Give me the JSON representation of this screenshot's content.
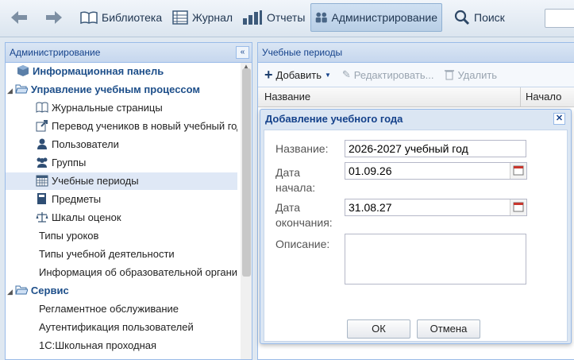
{
  "toolbar": {
    "library": "Библиотека",
    "journal": "Журнал",
    "reports": "Отчеты",
    "admin": "Администрирование",
    "search": "Поиск"
  },
  "left": {
    "title": "Администрирование",
    "collapse_glyph": "«",
    "items": [
      {
        "label": "Информационная панель",
        "icon": "info-panel-icon"
      },
      {
        "label": "Управление учебным процессом",
        "icon": "folder-icon"
      },
      {
        "label": "Журнальные страницы",
        "icon": "book-icon"
      },
      {
        "label": "Перевод учеников в новый учебный год",
        "icon": "transfer-icon"
      },
      {
        "label": "Пользователи",
        "icon": "user-icon"
      },
      {
        "label": "Группы",
        "icon": "group-icon"
      },
      {
        "label": "Учебные периоды",
        "icon": "calendar-icon"
      },
      {
        "label": "Предметы",
        "icon": "subject-icon"
      },
      {
        "label": "Шкалы оценок",
        "icon": "scales-icon"
      },
      {
        "label": "Типы уроков"
      },
      {
        "label": "Типы учебной деятельности"
      },
      {
        "label": "Информация об образовательной организации"
      },
      {
        "label": "Сервис",
        "icon": "folder-icon"
      },
      {
        "label": "Регламентное обслуживание"
      },
      {
        "label": "Аутентификация пользователей"
      },
      {
        "label": "1С:Школьная проходная"
      }
    ]
  },
  "right": {
    "title": "Учебные периоды",
    "add": "Добавить",
    "edit": "Редактировать...",
    "delete": "Удалить",
    "col_name": "Название",
    "col_start": "Начало"
  },
  "dialog": {
    "title": "Добавление учебного года",
    "close_glyph": "✕",
    "name_label": "Название:",
    "name_value": "2026-2027 учебный год",
    "start_label_1": "Дата",
    "start_label_2": "начала:",
    "start_value": "01.09.26",
    "end_label_1": "Дата",
    "end_label_2": "окончания:",
    "end_value": "31.08.27",
    "desc_label": "Описание:",
    "desc_value": "",
    "ok": "ОК",
    "cancel": "Отмена"
  },
  "colors": {
    "accent": "#15428b",
    "selected": "#dfe8f6",
    "panel_border": "#99bbe8"
  }
}
